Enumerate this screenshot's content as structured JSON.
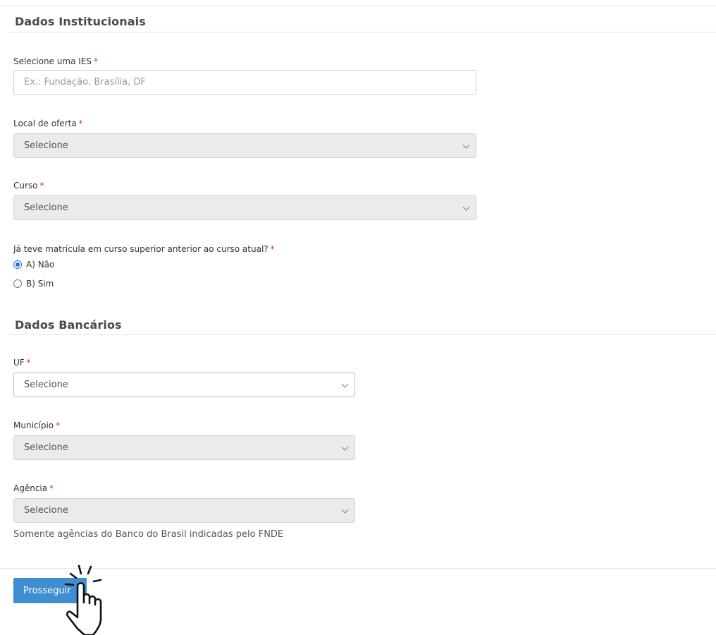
{
  "sections": {
    "institucional": {
      "title": "Dados Institucionais"
    },
    "bancario": {
      "title": "Dados Bancários"
    }
  },
  "ies": {
    "label": "Selecione uma IES",
    "required_mark": "*",
    "placeholder": "Ex.: Fundação, Brasília, DF"
  },
  "local_oferta": {
    "label": "Local de oferta",
    "required_mark": "*",
    "value": "Selecione"
  },
  "curso": {
    "label": "Curso",
    "required_mark": "*",
    "value": "Selecione"
  },
  "matricula": {
    "question": "Já teve matrícula em curso superior anterior ao curso atual?",
    "required_mark": "*",
    "options": [
      {
        "label": "A) Não",
        "checked": true
      },
      {
        "label": "B) Sim",
        "checked": false
      }
    ]
  },
  "uf": {
    "label": "UF",
    "required_mark": "*",
    "value": "Selecione"
  },
  "municipio": {
    "label": "Município",
    "required_mark": "*",
    "value": "Selecione"
  },
  "agencia": {
    "label": "Agência",
    "required_mark": "*",
    "value": "Selecione",
    "helper": "Somente agências do Banco do Brasil indicadas pelo FNDE"
  },
  "footer": {
    "submit_label": "Prosseguir"
  },
  "icons": {
    "pointer": "hand-pointer-icon"
  },
  "colors": {
    "primary": "#3f8ed2",
    "required": "#d9332b",
    "radio": "#1a73e8"
  }
}
